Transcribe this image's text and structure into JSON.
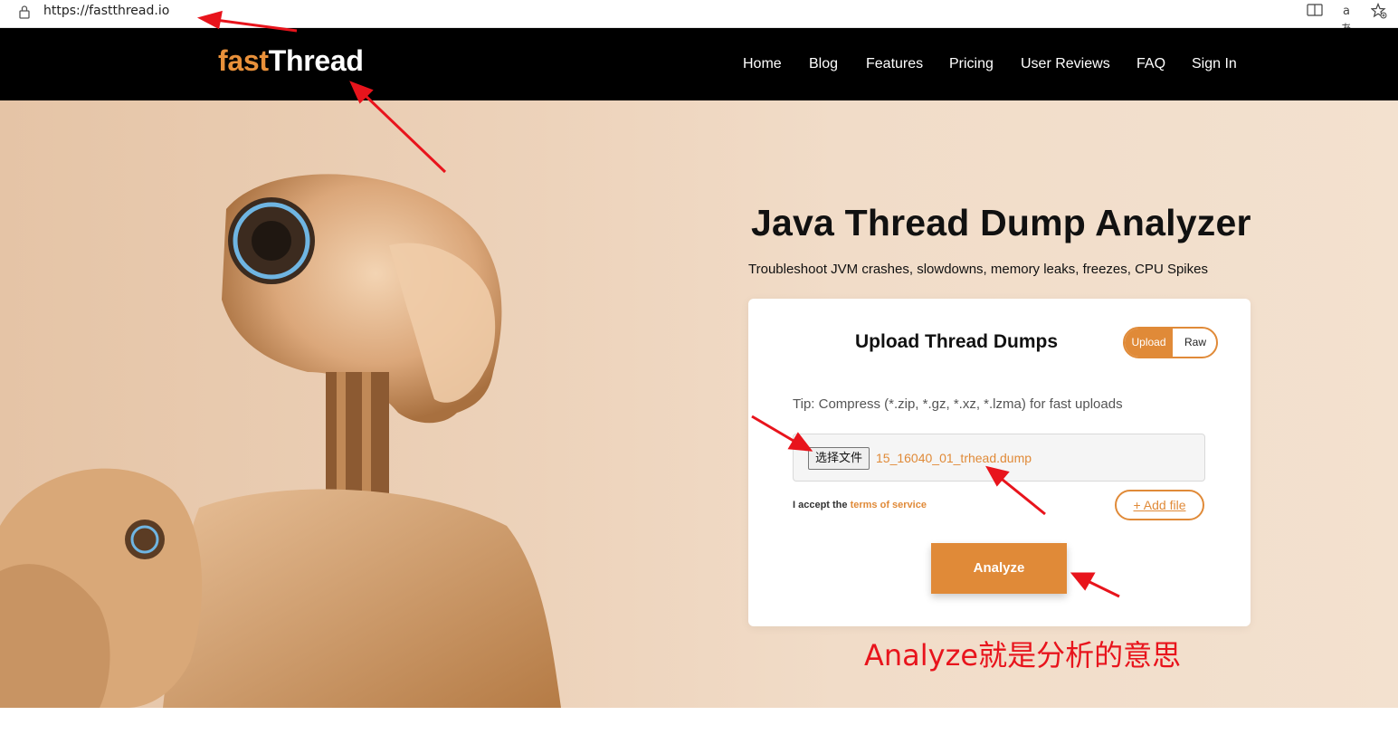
{
  "browser": {
    "url": "https://fastthread.io",
    "icons": [
      "lock-icon",
      "reader-mode-icon",
      "translate-icon",
      "favorite-icon"
    ],
    "translate_glyph": "aあ"
  },
  "nav": {
    "logo_fast": "fast",
    "logo_thread": "Thread",
    "links": [
      "Home",
      "Blog",
      "Features",
      "Pricing",
      "User Reviews",
      "FAQ",
      "Sign In"
    ]
  },
  "hero": {
    "title": "Java Thread Dump Analyzer",
    "subtitle": "Troubleshoot JVM crashes, slowdowns, memory leaks, freezes, CPU Spikes"
  },
  "upload": {
    "title": "Upload Thread Dumps",
    "toggle_upload": "Upload",
    "toggle_raw": "Raw",
    "tip": "Tip: Compress (*.zip, *.gz, *.xz, *.lzma) for fast uploads",
    "choose_file_label": "选择文件",
    "file_name": "15_16040_01_trhead.dump",
    "accept_prefix": "I accept the ",
    "terms_link": "terms of service",
    "add_file": "+ Add file",
    "analyze": "Analyze"
  },
  "annotation": {
    "text": "Analyze就是分析的意思",
    "color": "#e8141c"
  },
  "colors": {
    "accent": "#e08a38",
    "nav_bg": "#000000",
    "annotation_red": "#e8141c"
  }
}
